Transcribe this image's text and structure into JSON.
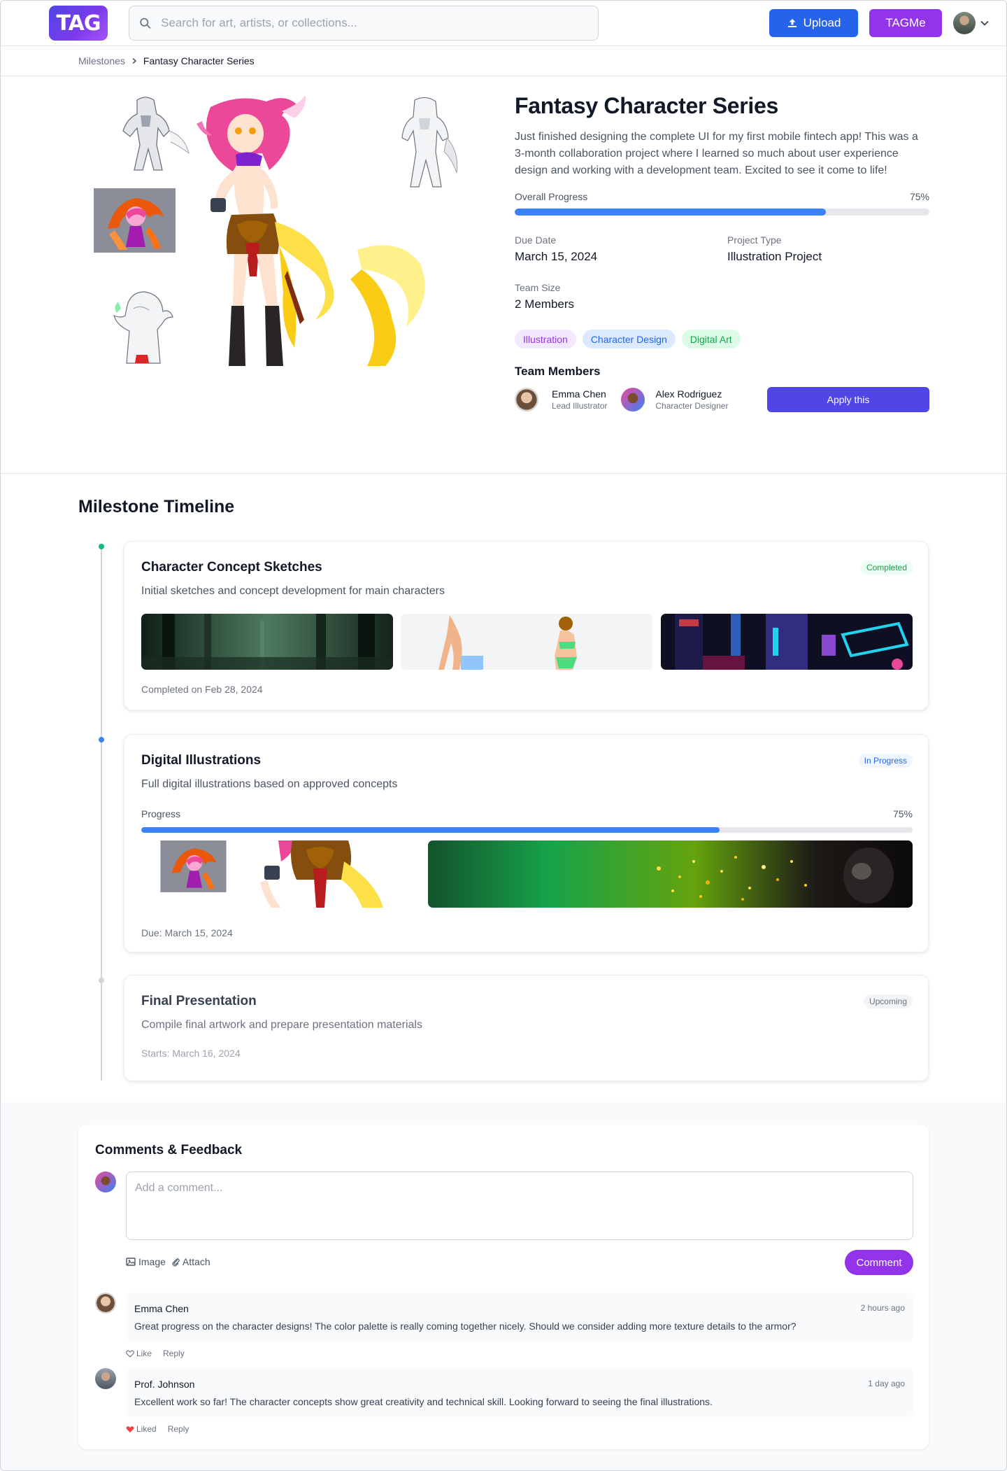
{
  "header": {
    "logo_text": "TAG",
    "search_placeholder": "Search for art, artists, or collections...",
    "upload_label": "Upload",
    "tagme_label": "TAGMe"
  },
  "breadcrumb": {
    "parent": "Milestones",
    "current": "Fantasy Character Series"
  },
  "project": {
    "title": "Fantasy Character Series",
    "description": "Just finished designing the complete UI for my first mobile fintech app! This was a 3-month collaboration project where I learned so much about user experience design and working with a development team. Excited to see it come to life!",
    "overall_progress_label": "Overall Progress",
    "overall_progress_text": "75%",
    "overall_progress": 0.75,
    "due_date_label": "Due Date",
    "due_date": "March 15, 2024",
    "project_type_label": "Project Type",
    "project_type": "Illustration Project",
    "team_size_label": "Team Size",
    "team_size": "2 Members",
    "tags": [
      {
        "label": "Illustration",
        "bg": "#f3e8ff",
        "fg": "#9333ea"
      },
      {
        "label": "Character Design",
        "bg": "#dbeafe",
        "fg": "#2563eb"
      },
      {
        "label": "Digital Art",
        "bg": "#dcfce7",
        "fg": "#16a34a"
      }
    ],
    "team_title": "Team Members",
    "members": [
      {
        "name": "Emma Chen",
        "role": "Lead Illustrator"
      },
      {
        "name": "Alex Rodriguez",
        "role": "Character Designer"
      }
    ],
    "apply_label": "Apply this"
  },
  "timeline": {
    "title": "Milestone Timeline",
    "milestones": [
      {
        "title": "Character Concept Sketches",
        "description": "Initial sketches and concept development for main characters",
        "status": "Completed",
        "status_color": "#16a34a",
        "footer": "Completed on Feb 28, 2024"
      },
      {
        "title": "Digital Illustrations",
        "description": "Full digital illustrations based on approved concepts",
        "status": "In Progress",
        "status_color": "#2563eb",
        "progress_label": "Progress",
        "progress_text": "75%",
        "progress": 0.75,
        "footer": "Due: March 15, 2024"
      },
      {
        "title": "Final Presentation",
        "description": "Compile final artwork and prepare presentation materials",
        "status": "Upcoming",
        "status_color": "#6b7280",
        "footer": "Starts: March 16, 2024"
      }
    ]
  },
  "comments": {
    "title": "Comments & Feedback",
    "input_placeholder": "Add a comment...",
    "image_label": "Image",
    "attach_label": "Attach",
    "submit_label": "Comment",
    "items": [
      {
        "author": "Emma Chen",
        "time": "2 hours ago",
        "text": "Great progress on the character designs! The color palette is really coming together nicely. Should we consider adding more texture details to the armor?",
        "like_label": "Like",
        "reply_label": "Reply",
        "liked": false
      },
      {
        "author": "Prof. Johnson",
        "time": "1 day ago",
        "text": "Excellent work so far! The character concepts show great creativity and technical skill. Looking forward to seeing the final illustrations.",
        "like_label": "Liked",
        "reply_label": "Reply",
        "liked": true
      }
    ]
  },
  "colors": {
    "primary_blue": "#2563eb",
    "purple": "#9333ea",
    "indigo": "#4f46e5",
    "progress_blue": "#3b82f6"
  }
}
